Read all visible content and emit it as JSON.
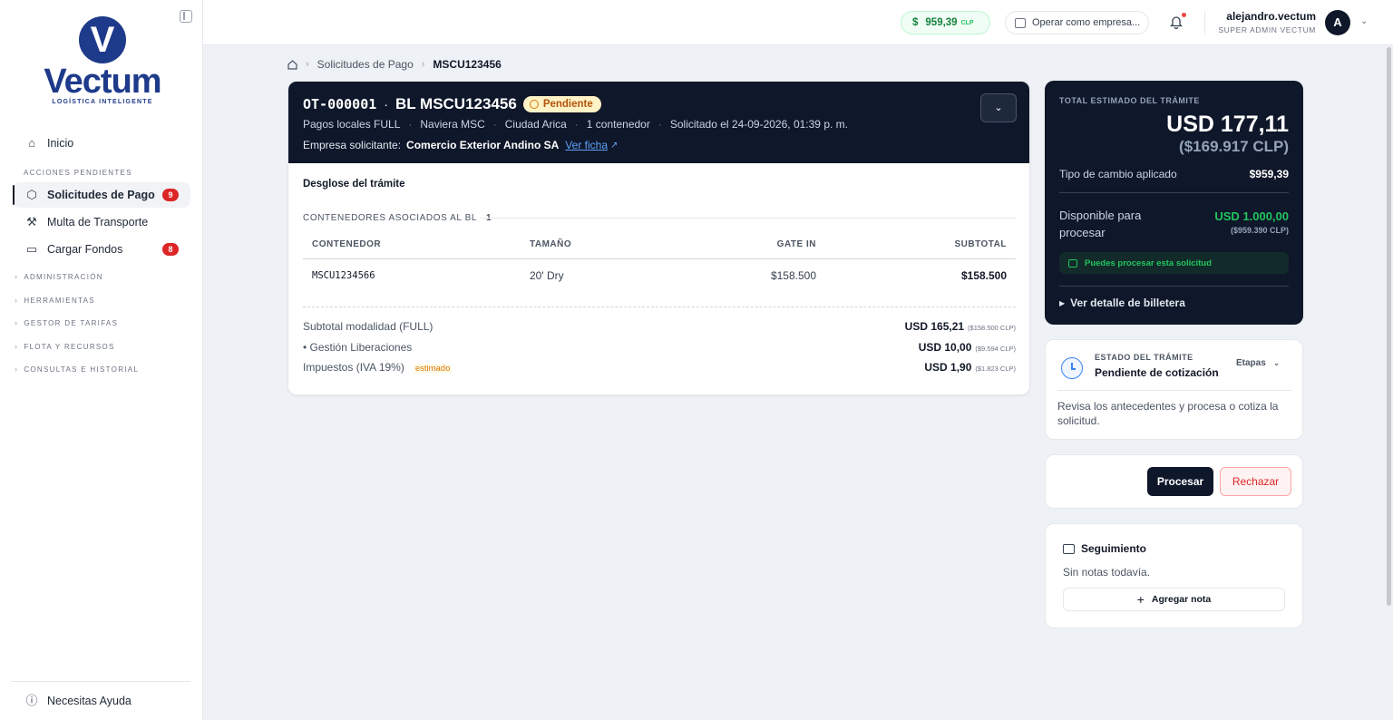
{
  "brand": {
    "logo_letter": "V",
    "name": "Vectum",
    "tagline": "LOGÍSTICA INTELIGENTE"
  },
  "sidebar": {
    "home_label": "Inicio",
    "pending_section": "ACCIONES PENDIENTES",
    "items": [
      {
        "label": "Solicitudes de Pago",
        "badge": "9",
        "icon": "box-icon"
      },
      {
        "label": "Multa de Transporte",
        "icon": "gavel-icon"
      },
      {
        "label": "Cargar Fondos",
        "badge": "8",
        "icon": "wallet-icon"
      }
    ],
    "groups": [
      "ADMINISTRACIÓN",
      "HERRAMIENTAS",
      "GESTOR DE TARIFAS",
      "FLOTA Y RECURSOS",
      "CONSULTAS E HISTORIAL"
    ],
    "help_label": "Necesitas Ayuda"
  },
  "topbar": {
    "rate_symbol": "$",
    "rate_value": "959,39",
    "rate_currency": "CLP",
    "company_placeholder": "Operar como empresa...",
    "user_name": "alejandro.vectum",
    "user_role": "SUPER ADMIN VECTUM",
    "avatar_letter": "A"
  },
  "breadcrumb": {
    "level1": "Solicitudes de Pago",
    "current": "MSCU123456"
  },
  "request": {
    "ot": "OT-000001",
    "bl": "BL MSCU123456",
    "status": "Pendiente",
    "meta": [
      "Pagos locales FULL",
      "Naviera MSC",
      "Ciudad Arica",
      "1 contenedor",
      "Solicitado el 24-09-2026, 01:39 p. m."
    ],
    "company_label": "Empresa solicitante:",
    "company_name": "Comercio Exterior Andino SA",
    "company_link": "Ver ficha"
  },
  "breakdown": {
    "title": "Desglose del trámite",
    "containers_label": "CONTENEDORES ASOCIADOS AL BL",
    "containers_count": "1",
    "columns": [
      "CONTENEDOR",
      "TAMAÑO",
      "GATE IN",
      "SUBTOTAL"
    ],
    "rows": [
      {
        "container": "MSCU1234566",
        "size": "20' Dry",
        "gate_in": "$158.500",
        "subtotal": "$158.500"
      }
    ],
    "summary": [
      {
        "label": "Subtotal modalidad (FULL)",
        "usd": "USD 165,21",
        "clp": "($158.500 CLP)"
      },
      {
        "label": "• Gestión Liberaciones",
        "usd": "USD 10,00",
        "clp": "($9.594 CLP)"
      },
      {
        "label": "Impuestos (IVA 19%)",
        "tag": "estimado",
        "usd": "USD 1,90",
        "clp": "($1.823 CLP)"
      }
    ]
  },
  "total": {
    "label": "TOTAL ESTIMADO DEL TRÁMITE",
    "usd": "USD 177,11",
    "clp": "($169.917 CLP)",
    "rate_label": "Tipo de cambio aplicado",
    "rate_value": "$959,39",
    "available_label": "Disponible para procesar",
    "available_usd": "USD 1.000,00",
    "available_clp": "($959.390 CLP)",
    "ok_message": "Puedes procesar esta solicitud",
    "wallet_detail": "Ver detalle de billetera"
  },
  "status_card": {
    "label": "ESTADO DEL TRÁMITE",
    "value": "Pendiente de cotización",
    "stages": "Etapas",
    "description": "Revisa los antecedentes y procesa o cotiza la solicitud."
  },
  "actions": {
    "process": "Procesar",
    "reject": "Rechazar"
  },
  "followup": {
    "title": "Seguimiento",
    "empty": "Sin notas todavía.",
    "add": "Agregar nota"
  }
}
